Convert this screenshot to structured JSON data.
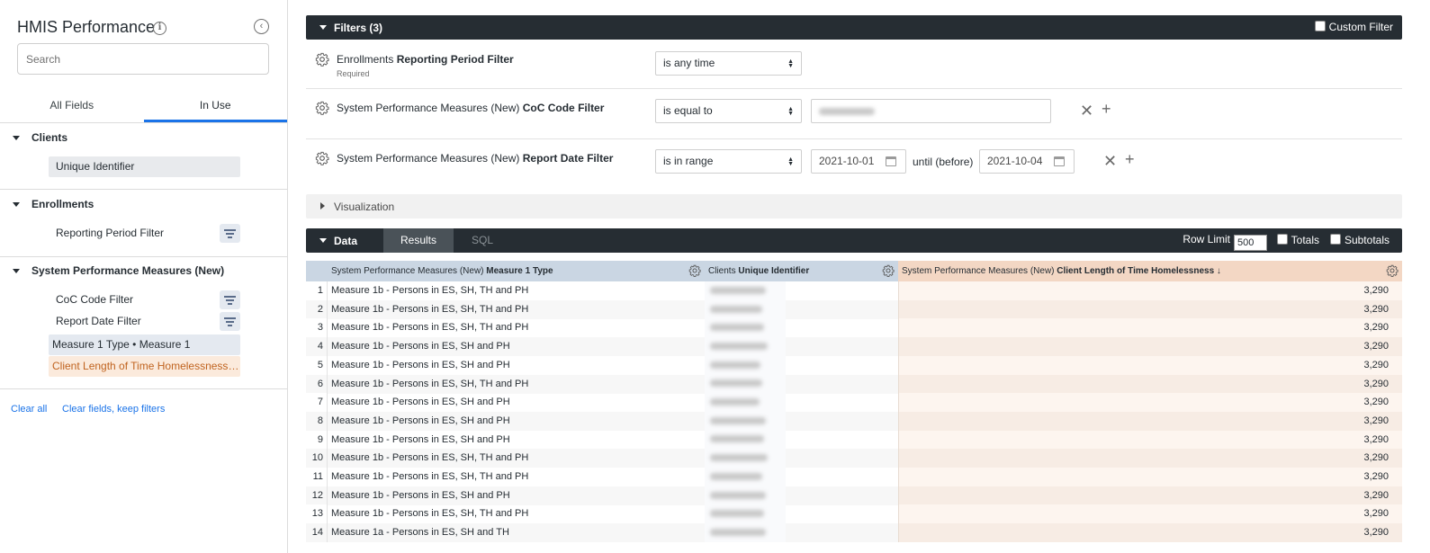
{
  "sidebar": {
    "title": "HMIS Performance",
    "search_placeholder": "Search",
    "tabs": [
      "All Fields",
      "In Use"
    ],
    "groups": [
      {
        "name": "Clients",
        "fields": [
          "Unique Identifier"
        ]
      },
      {
        "name": "Enrollments",
        "fields": [
          "Reporting Period Filter"
        ]
      },
      {
        "name": "System Performance Measures (New)",
        "fields": [
          "CoC Code Filter",
          "Report Date Filter",
          "Measure 1 Type • Measure 1",
          "Client Length of Time Homelessness •…"
        ]
      }
    ],
    "clear_all": "Clear all",
    "clear_fields": "Clear fields, keep filters"
  },
  "filters": {
    "header": "Filters (3)",
    "custom_filter": "Custom Filter",
    "rows": [
      {
        "prefix": "Enrollments",
        "name": "Reporting Period Filter",
        "sub": "Required",
        "operator": "is any time"
      },
      {
        "prefix": "System Performance Measures (New)",
        "name": "CoC Code Filter",
        "operator": "is equal to"
      },
      {
        "prefix": "System Performance Measures (New)",
        "name": "Report Date Filter",
        "operator": "is in range",
        "from": "2021-10-01",
        "until_label": "until (before)",
        "to": "2021-10-04"
      }
    ]
  },
  "visualization": {
    "label": "Visualization"
  },
  "data": {
    "label": "Data",
    "tabs": [
      "Results",
      "SQL"
    ],
    "row_limit_label": "Row Limit",
    "row_limit": "500",
    "totals": "Totals",
    "subtotals": "Subtotals"
  },
  "table": {
    "columns": [
      {
        "prefix": "System Performance Measures (New)",
        "name": "Measure 1 Type"
      },
      {
        "prefix": "Clients",
        "name": "Unique Identifier"
      },
      {
        "prefix": "System Performance Measures (New)",
        "name": "Client Length of Time Homelessness ↓"
      }
    ],
    "rows": [
      {
        "n": "1",
        "type": "Measure 1b - Persons in ES, SH, TH and PH",
        "los": "3,290"
      },
      {
        "n": "2",
        "type": "Measure 1b - Persons in ES, SH, TH and PH",
        "los": "3,290"
      },
      {
        "n": "3",
        "type": "Measure 1b - Persons in ES, SH, TH and PH",
        "los": "3,290"
      },
      {
        "n": "4",
        "type": "Measure 1b - Persons in ES, SH and PH",
        "los": "3,290"
      },
      {
        "n": "5",
        "type": "Measure 1b - Persons in ES, SH and PH",
        "los": "3,290"
      },
      {
        "n": "6",
        "type": "Measure 1b - Persons in ES, SH, TH and PH",
        "los": "3,290"
      },
      {
        "n": "7",
        "type": "Measure 1b - Persons in ES, SH and PH",
        "los": "3,290"
      },
      {
        "n": "8",
        "type": "Measure 1b - Persons in ES, SH and PH",
        "los": "3,290"
      },
      {
        "n": "9",
        "type": "Measure 1b - Persons in ES, SH and PH",
        "los": "3,290"
      },
      {
        "n": "10",
        "type": "Measure 1b - Persons in ES, SH, TH and PH",
        "los": "3,290"
      },
      {
        "n": "11",
        "type": "Measure 1b - Persons in ES, SH, TH and PH",
        "los": "3,290"
      },
      {
        "n": "12",
        "type": "Measure 1b - Persons in ES, SH and PH",
        "los": "3,290"
      },
      {
        "n": "13",
        "type": "Measure 1b - Persons in ES, SH, TH and PH",
        "los": "3,290"
      },
      {
        "n": "14",
        "type": "Measure 1a - Persons in ES, SH and TH",
        "los": "3,290"
      }
    ]
  }
}
